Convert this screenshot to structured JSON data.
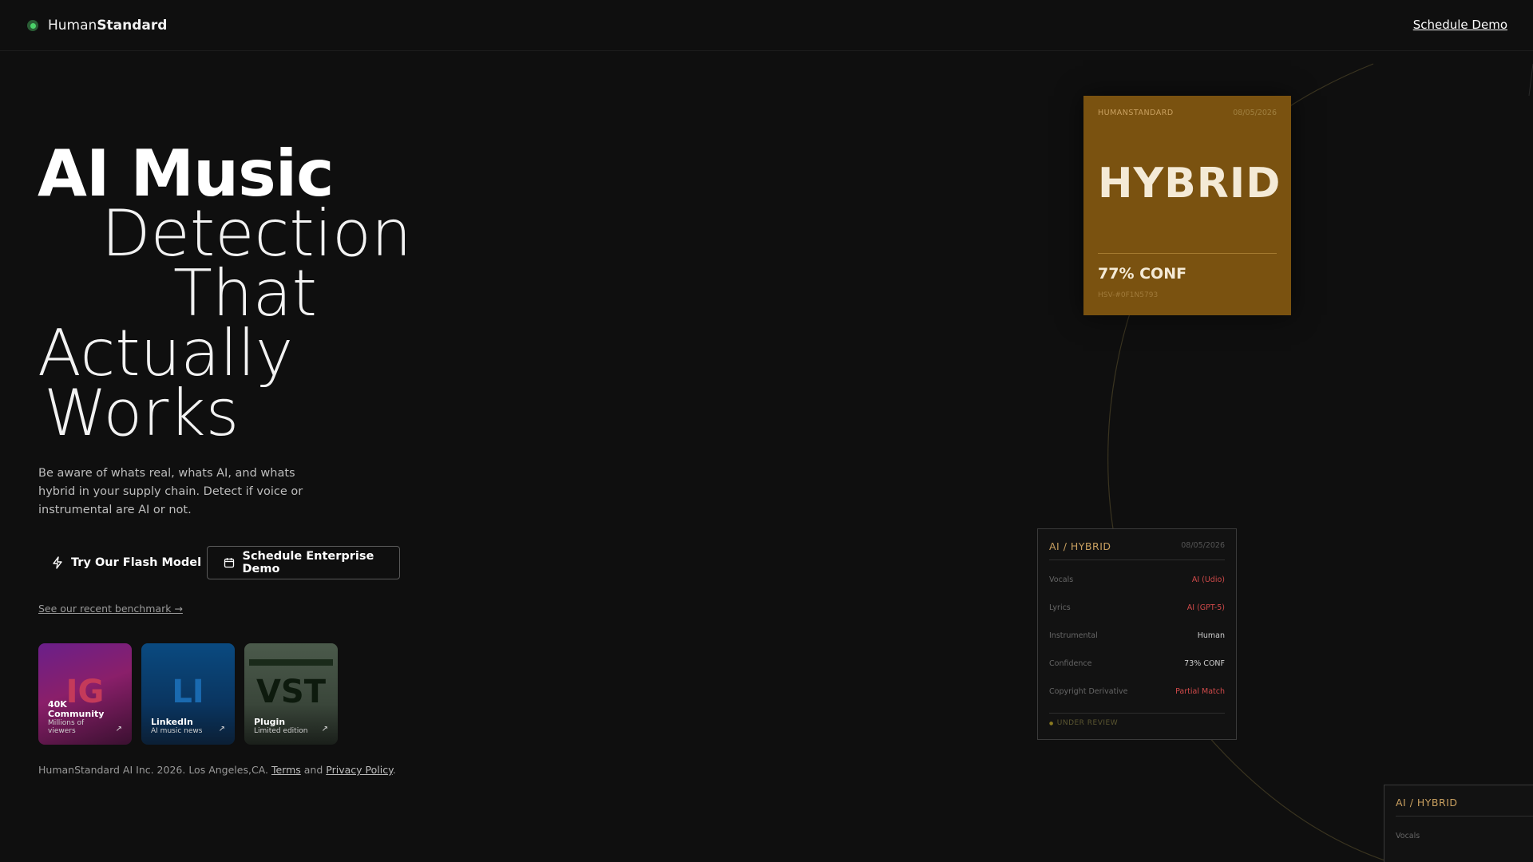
{
  "header": {
    "brand_prefix": "Human",
    "brand_suffix": "Standard",
    "cta": "Schedule Demo"
  },
  "hero": {
    "line1": "AI Music",
    "line2": "Detection",
    "line3": "That",
    "line4": "Actually",
    "line5": "Works",
    "subtitle": "Be aware of whats real, whats AI, and whats hybrid in your supply chain. Detect if voice or instrumental are AI or not.",
    "primary_button": "Try Our Flash Model",
    "secondary_button": "Schedule Enterprise Demo",
    "benchmark_link": "See our recent benchmark →"
  },
  "tiles": [
    {
      "big": "IG",
      "name": "40K Community",
      "sub": "Millions of viewers"
    },
    {
      "big": "LI",
      "name": "LinkedIn",
      "sub": "AI music news"
    },
    {
      "big": "VST",
      "name": "Plugin",
      "sub": "Limited edition"
    }
  ],
  "footer": {
    "text": "HumanStandard AI Inc. 2026. Los Angeles,CA.",
    "terms": "Terms",
    "and": "and",
    "privacy": "Privacy Policy",
    "period": "."
  },
  "hybrid_card": {
    "brand": "HUMANSTANDARD",
    "date": "08/05/2026",
    "verdict": "HYBRID",
    "confidence": "77% CONF",
    "id": "HSV-#0F1N5793"
  },
  "detail_card": {
    "title": "AI / HYBRID",
    "date": "08/05/2026",
    "rows": [
      {
        "key": "Vocals",
        "value": "AI (Udio)",
        "ai": true
      },
      {
        "key": "Lyrics",
        "value": "AI (GPT-5)",
        "ai": true
      },
      {
        "key": "Instrumental",
        "value": "Human",
        "ai": false
      },
      {
        "key": "Confidence",
        "value": "73% CONF",
        "ai": false
      },
      {
        "key": "Copyright Derivative",
        "value": "Partial Match",
        "ai": true
      }
    ],
    "status": "UNDER REVIEW"
  },
  "partial_card": {
    "title": "AI / HYBRID",
    "first_key": "Vocals"
  },
  "colors": {
    "background": "#0f0f0f",
    "card_gold": "#7a5210",
    "accent_gold": "#c9a060",
    "ai_red": "#d04a4a",
    "logo_green": "#4bd26a"
  }
}
